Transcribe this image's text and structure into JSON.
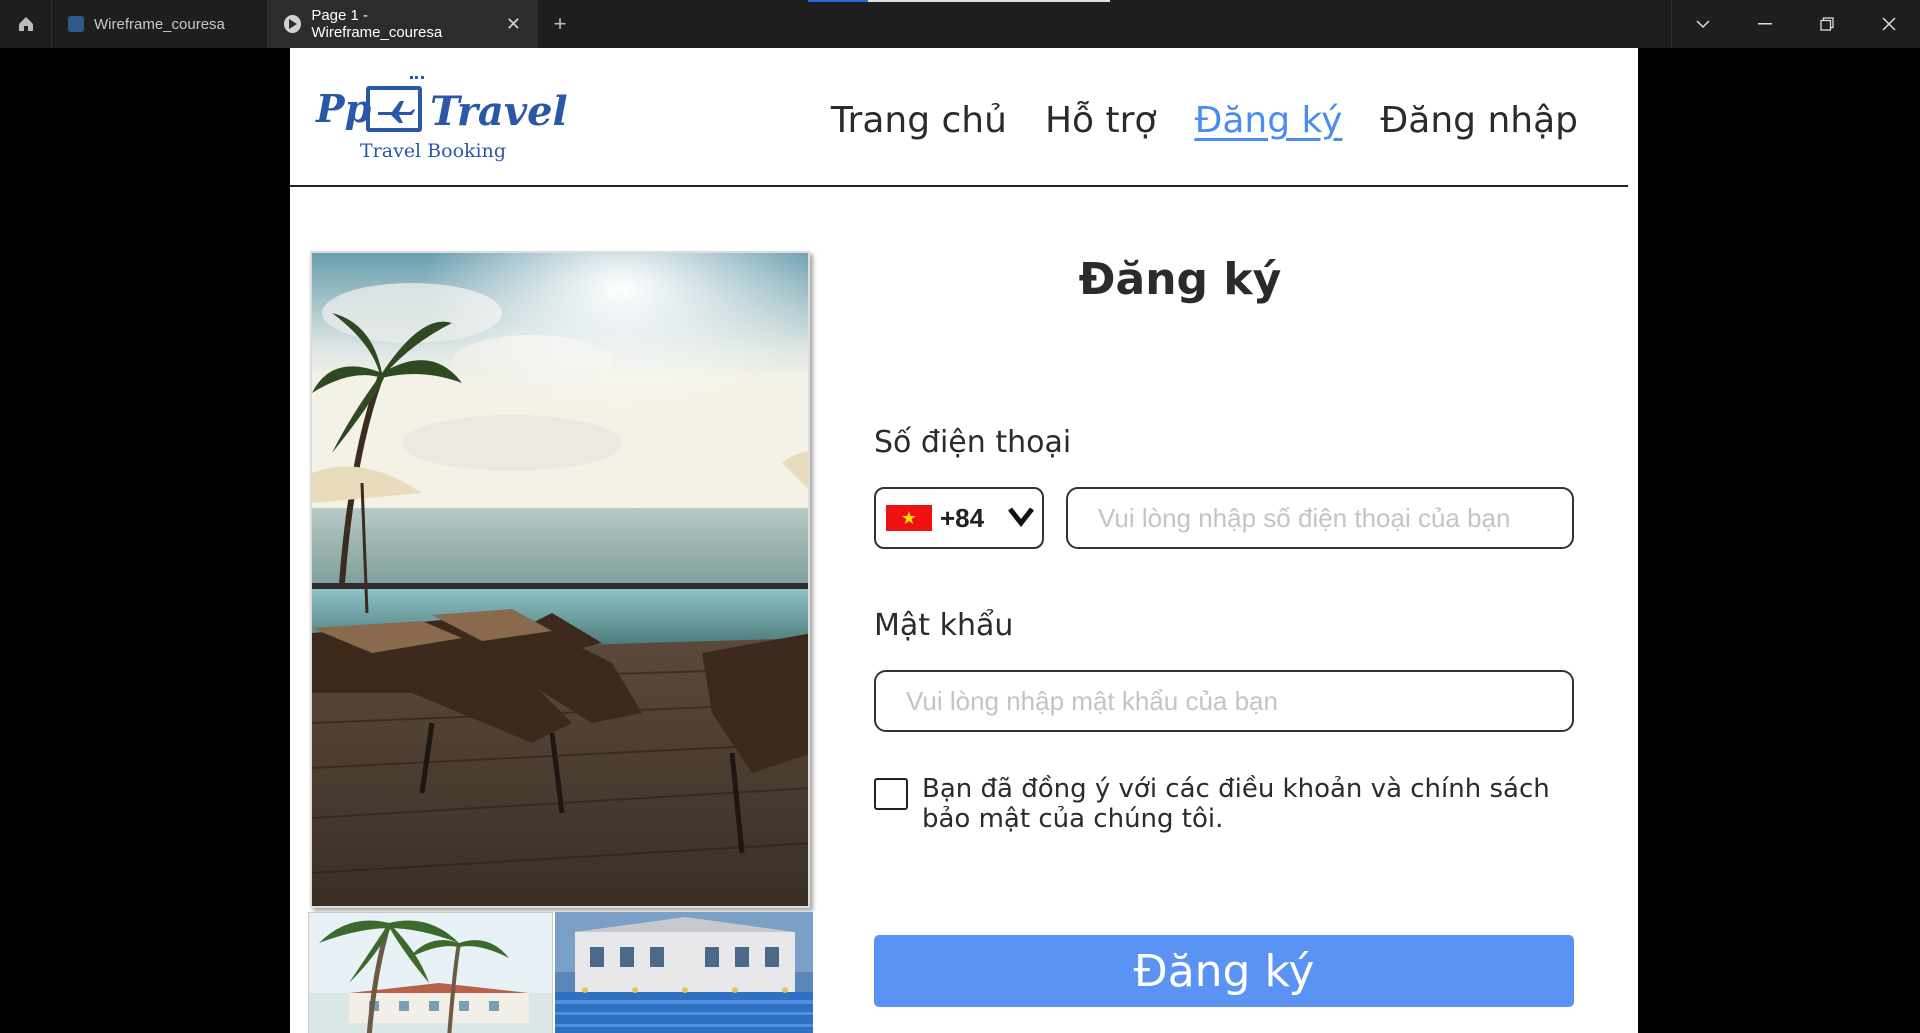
{
  "window": {
    "tabs": [
      {
        "label": "Wireframe_couresa"
      },
      {
        "label": "Page 1 - Wireframe_couresa"
      }
    ]
  },
  "site": {
    "logo": {
      "brand_left": "Pp",
      "brand_right": "Travel",
      "tagline": "Travel Booking"
    },
    "nav": [
      {
        "label": "Trang chủ"
      },
      {
        "label": "Hỗ trợ"
      },
      {
        "label": "Đăng ký"
      },
      {
        "label": "Đăng nhập"
      }
    ]
  },
  "form": {
    "title": "Đăng ký",
    "phone_label": "Số điện thoại",
    "country_code": "+84",
    "phone_placeholder": "Vui lòng nhập số điện thoại của bạn",
    "password_label": "Mật khẩu",
    "password_placeholder": "Vui lòng nhập mật khẩu của bạn",
    "terms_text": "Bạn đã đồng ý với các điều khoản và chính sách bảo mật của chúng tôi.",
    "submit_label": "Đăng ký"
  },
  "colors": {
    "accent": "#5a93f3",
    "brand": "#2a57a8",
    "active_nav": "#4a8cf0"
  }
}
